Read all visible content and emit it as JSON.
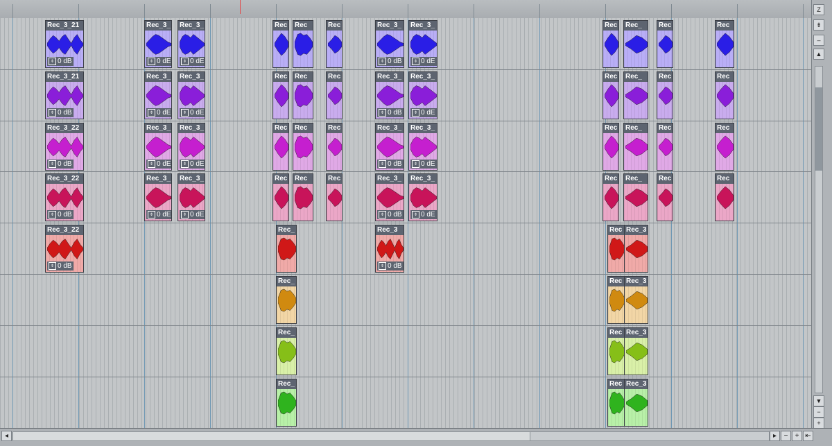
{
  "timeline": {
    "bar_count": 12
  },
  "tracks": [
    {
      "color": "#b9aef6",
      "wave": "#2a1ee6",
      "clips": [
        {
          "name": "Rec_3_21",
          "gain": "0 dB",
          "wave_shape": "a"
        },
        {
          "name": "Rec_3_",
          "gain": "0 dE",
          "wave_shape": "b"
        },
        {
          "name": "Rec_3_",
          "gain": "0 dE",
          "wave_shape": "c"
        },
        {
          "name": "Rec",
          "gain": "",
          "wave_shape": "d"
        },
        {
          "name": "Rec",
          "gain": "",
          "wave_shape": "e"
        },
        {
          "name": "Rec",
          "gain": "",
          "wave_shape": "f"
        },
        {
          "name": "Rec_3_",
          "gain": "0 dB",
          "wave_shape": "b"
        },
        {
          "name": "Rec_3_",
          "gain": "0 dE",
          "wave_shape": "c"
        },
        {
          "name": "Rec",
          "gain": "",
          "wave_shape": "d"
        },
        {
          "name": "Rec_",
          "gain": "",
          "wave_shape": "f"
        },
        {
          "name": "Rec",
          "gain": "",
          "wave_shape": "f"
        },
        {
          "name": "Rec",
          "gain": "",
          "wave_shape": "d"
        }
      ]
    },
    {
      "color": "#c9acee",
      "wave": "#8a1ed9",
      "clips": [
        {
          "name": "Rec_3_21",
          "gain": "0 dB",
          "wave_shape": "a"
        },
        {
          "name": "Rec_3_",
          "gain": "0 dE",
          "wave_shape": "b"
        },
        {
          "name": "Rec_3_",
          "gain": "0 dE",
          "wave_shape": "c"
        },
        {
          "name": "Rec",
          "gain": "",
          "wave_shape": "d"
        },
        {
          "name": "Rec",
          "gain": "",
          "wave_shape": "e"
        },
        {
          "name": "Rec",
          "gain": "",
          "wave_shape": "f"
        },
        {
          "name": "Rec_3_",
          "gain": "0 dB",
          "wave_shape": "b"
        },
        {
          "name": "Rec_3_",
          "gain": "0 dE",
          "wave_shape": "c"
        },
        {
          "name": "Rec",
          "gain": "",
          "wave_shape": "d"
        },
        {
          "name": "Rec_",
          "gain": "",
          "wave_shape": "f"
        },
        {
          "name": "Rec",
          "gain": "",
          "wave_shape": "f"
        },
        {
          "name": "Rec",
          "gain": "",
          "wave_shape": "d"
        }
      ]
    },
    {
      "color": "#e0a9e6",
      "wave": "#c51fcf",
      "clips": [
        {
          "name": "Rec_3_22",
          "gain": "0 dB",
          "wave_shape": "a"
        },
        {
          "name": "Rec_3_",
          "gain": "0 dE",
          "wave_shape": "b"
        },
        {
          "name": "Rec_3_",
          "gain": "0 dE",
          "wave_shape": "c"
        },
        {
          "name": "Rec",
          "gain": "",
          "wave_shape": "d"
        },
        {
          "name": "Rec",
          "gain": "",
          "wave_shape": "e"
        },
        {
          "name": "Rec",
          "gain": "",
          "wave_shape": "f"
        },
        {
          "name": "Rec_3_",
          "gain": "0 dB",
          "wave_shape": "b"
        },
        {
          "name": "Rec_3_",
          "gain": "0 dE",
          "wave_shape": "c"
        },
        {
          "name": "Rec",
          "gain": "",
          "wave_shape": "d"
        },
        {
          "name": "Rec_",
          "gain": "",
          "wave_shape": "f"
        },
        {
          "name": "Rec",
          "gain": "",
          "wave_shape": "f"
        },
        {
          "name": "Rec",
          "gain": "",
          "wave_shape": "d"
        }
      ]
    },
    {
      "color": "#eba7c7",
      "wave": "#c8145a",
      "clips": [
        {
          "name": "Rec_3_22",
          "gain": "0 dB",
          "wave_shape": "a"
        },
        {
          "name": "Rec_3_",
          "gain": "0 dE",
          "wave_shape": "b"
        },
        {
          "name": "Rec_3_",
          "gain": "0 dE",
          "wave_shape": "c"
        },
        {
          "name": "Rec",
          "gain": "",
          "wave_shape": "d"
        },
        {
          "name": "Rec",
          "gain": "",
          "wave_shape": "e"
        },
        {
          "name": "Rec",
          "gain": "",
          "wave_shape": "f"
        },
        {
          "name": "Rec_3_",
          "gain": "0 dB",
          "wave_shape": "b"
        },
        {
          "name": "Rec_3_",
          "gain": "0 dE",
          "wave_shape": "c"
        },
        {
          "name": "Rec",
          "gain": "",
          "wave_shape": "d"
        },
        {
          "name": "Rec_",
          "gain": "",
          "wave_shape": "f"
        },
        {
          "name": "Rec",
          "gain": "",
          "wave_shape": "f"
        },
        {
          "name": "Rec",
          "gain": "",
          "wave_shape": "d"
        }
      ]
    },
    {
      "color": "#f0aaa8",
      "wave": "#d01818",
      "clips": [
        {
          "name": "Rec_3_22",
          "gain": "0 dB",
          "wave_shape": "a"
        },
        {
          "name": "Rec_",
          "gain": "",
          "wave_shape": "e"
        },
        {
          "name": "Rec_3",
          "gain": "0 dB",
          "wave_shape": "a"
        },
        {
          "name": "Rec",
          "gain": "",
          "wave_shape": "e"
        },
        {
          "name": "Rec_3",
          "gain": "",
          "wave_shape": "f"
        }
      ]
    },
    {
      "color": "#f2d6a6",
      "wave": "#d08a10",
      "clips": [
        {
          "name": "Rec_",
          "gain": "",
          "wave_shape": "e"
        },
        {
          "name": "Rec",
          "gain": "",
          "wave_shape": "e"
        },
        {
          "name": "Rec_3",
          "gain": "",
          "wave_shape": "f"
        }
      ]
    },
    {
      "color": "#d9f0a8",
      "wave": "#86bf18",
      "clips": [
        {
          "name": "Rec_",
          "gain": "",
          "wave_shape": "e"
        },
        {
          "name": "Rec",
          "gain": "",
          "wave_shape": "e"
        },
        {
          "name": "Rec_3",
          "gain": "",
          "wave_shape": "f"
        }
      ]
    },
    {
      "color": "#b8f0a8",
      "wave": "#2fb31e",
      "clips": [
        {
          "name": "Rec_",
          "gain": "",
          "wave_shape": "e"
        },
        {
          "name": "Rec",
          "gain": "",
          "wave_shape": "e"
        },
        {
          "name": "Rec_3",
          "gain": "",
          "wave_shape": "f"
        }
      ]
    }
  ]
}
